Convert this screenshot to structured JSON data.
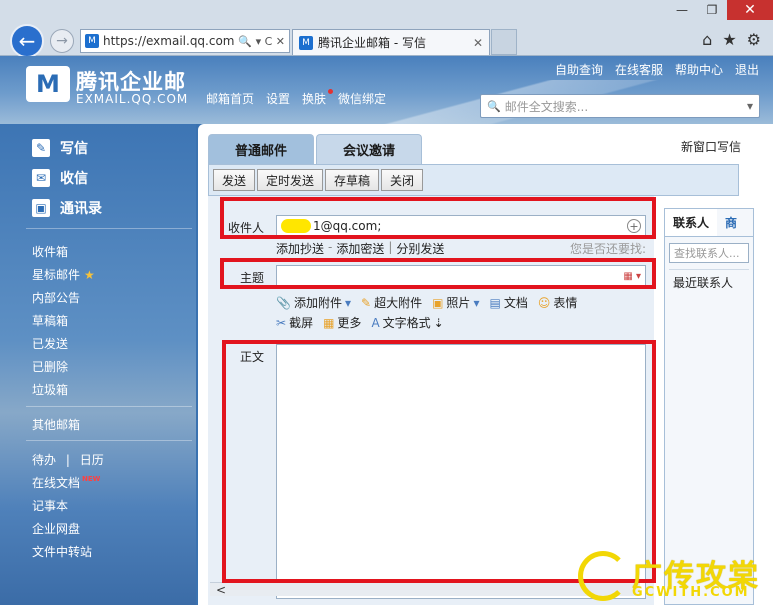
{
  "browser": {
    "url": "https://exmail.qq.com/",
    "tab_title": "腾讯企业邮箱 - 写信",
    "back_glyph": "←",
    "fwd_glyph": "→",
    "addr_controls": "🔍 ▾ C ✕",
    "tab_close": "✕",
    "favicon": "M",
    "window_controls": [
      "—",
      "❐",
      "✕"
    ],
    "chrome_icons": [
      "⌂",
      "★",
      "⚙"
    ]
  },
  "header": {
    "logo_mark": "M",
    "brand_cn": "腾讯企业邮",
    "brand_en": "EXMAIL.QQ.COM",
    "nav": [
      "邮箱首页",
      "设置",
      "换肤",
      "微信绑定"
    ],
    "links": [
      "自助查询",
      "在线客服",
      "帮助中心",
      "退出"
    ],
    "search_placeholder": "邮件全文搜索...",
    "search_icon": "search-icon",
    "search_glyph": "🔍",
    "search_caret": "▾"
  },
  "sidebar": {
    "main": [
      {
        "label": "写信",
        "icon": "compose-icon",
        "glyph": "✎"
      },
      {
        "label": "收信",
        "icon": "inbox-icon",
        "glyph": "✉"
      },
      {
        "label": "通讯录",
        "icon": "contacts-icon",
        "glyph": "▣"
      }
    ],
    "folders": [
      "收件箱",
      "星标邮件",
      "内部公告",
      "草稿箱",
      "已发送",
      "已删除",
      "垃圾箱"
    ],
    "star_glyph": "★",
    "other": "其他邮箱",
    "todo": "待办",
    "todo_sep": "|",
    "calendar": "日历",
    "online_docs": "在线文档",
    "new_badge": "NEW",
    "tools": [
      "记事本",
      "企业网盘",
      "文件中转站"
    ]
  },
  "compose": {
    "tabs": [
      "普通邮件",
      "会议邀请"
    ],
    "new_window": "新窗口写信",
    "toolbar": [
      "发送",
      "定时发送",
      "存草稿",
      "关闭"
    ],
    "to_label": "收件人",
    "to_value": "1@qq.com;",
    "plus_glyph": "+",
    "add_cc": "添加抄送",
    "add_bcc": "添加密送",
    "separate_send": "分别发送",
    "sep_dash": "-",
    "sep_bar": "|",
    "find_question": "您是否还要找:",
    "subject_label": "主题",
    "subject_value": "",
    "grid_glyph": "▦ ▾",
    "attach": {
      "add_attachment": "添加附件",
      "large_attachment": "超大附件",
      "photo": "照片",
      "document": "文档",
      "emoji": "表情",
      "screenshot": "截屏",
      "more": "更多",
      "text_format": "文字格式"
    },
    "attach_glyphs": {
      "clip": "📎",
      "caret": "▾",
      "large": "✎",
      "photo": "▣",
      "doc": "▤",
      "emoji": "☺",
      "scissors": "✂",
      "more": "▦",
      "text": "A",
      "text_arrow": "⇣"
    },
    "body_label": "正文"
  },
  "contacts": {
    "tabs": [
      "联系人",
      "商"
    ],
    "search_placeholder": "查找联系人...",
    "recent": "最近联系人"
  },
  "scroll_arrow": "<",
  "watermark": {
    "cn": "广传攻棠",
    "en": "GCWITH.COM"
  },
  "colors": {
    "highlight_red": "#e2141e",
    "sidebar_blue": "#3d75b4",
    "redaction_yellow": "#ffe600",
    "watermark_yellow": "#f2d705"
  }
}
